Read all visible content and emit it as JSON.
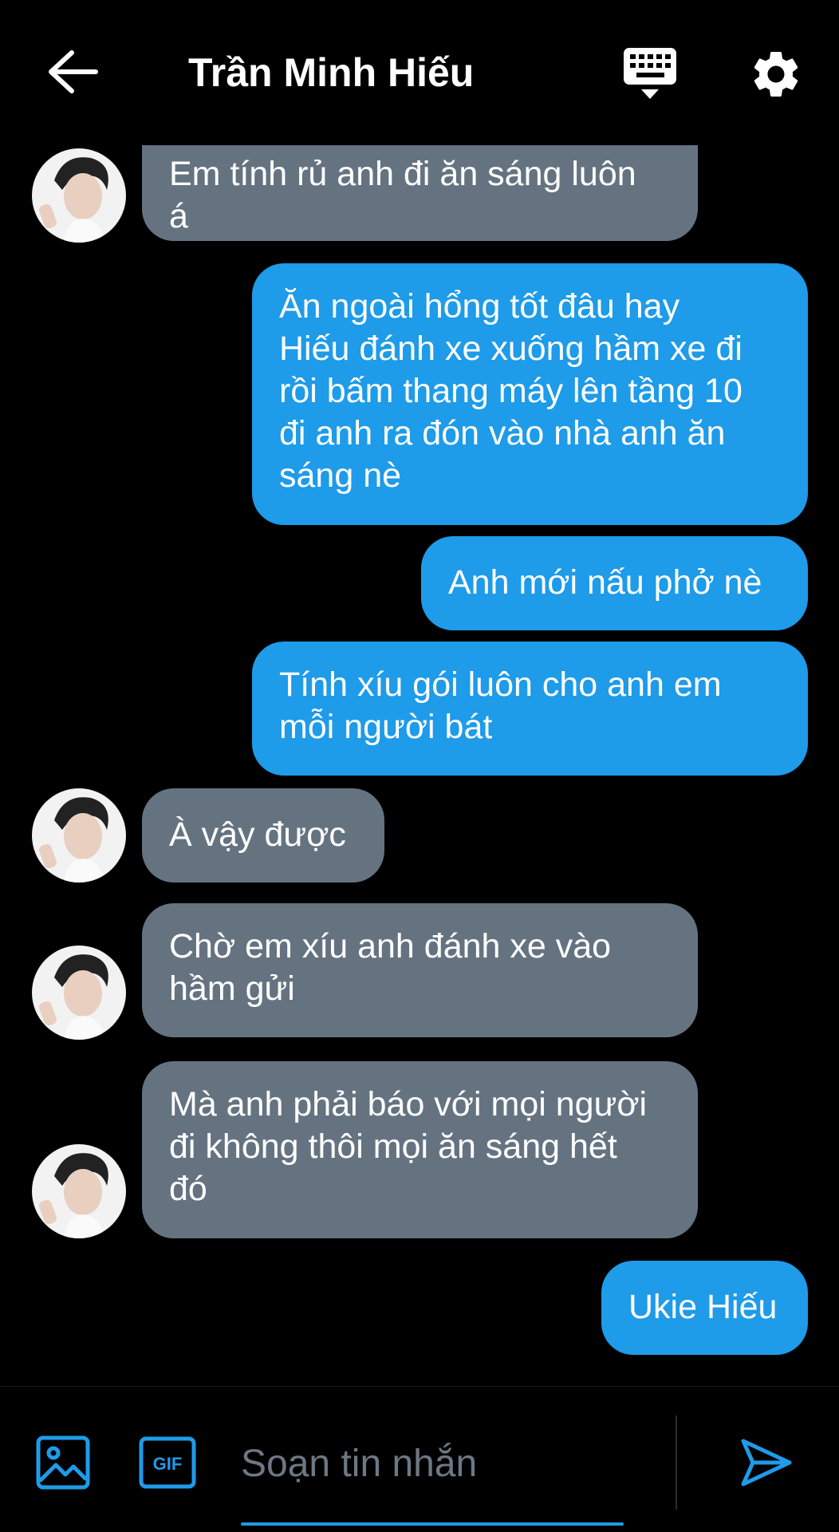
{
  "header": {
    "title": "Trần Minh Hiếu"
  },
  "messages": [
    {
      "direction": "incoming",
      "text": "Em tính rủ anh đi ăn sáng luôn\ná",
      "partially_visible": true
    },
    {
      "direction": "outgoing",
      "text": "Ăn ngoài hổng tốt đâu hay\nHiếu đánh xe xuống hầm xe đi\nrồi bấm thang máy lên tầng 10\nđi anh ra đón vào nhà anh ăn\nsáng nè"
    },
    {
      "direction": "outgoing",
      "text": "Anh mới nấu phở nè"
    },
    {
      "direction": "outgoing",
      "text": "Tính xíu gói luôn cho anh em\nmỗi người bát"
    },
    {
      "direction": "incoming",
      "text": "À vậy được"
    },
    {
      "direction": "incoming",
      "text": "Chờ em xíu anh đánh xe vào\nhầm gửi"
    },
    {
      "direction": "incoming",
      "text": "Mà anh phải báo với mọi người\nđi không thôi mọi ăn sáng hết\nđó"
    },
    {
      "direction": "outgoing",
      "text": "Ukie Hiếu"
    }
  ],
  "composer": {
    "placeholder": "Soạn tin nhắn",
    "gif_label": "GIF"
  },
  "colors": {
    "background": "#000000",
    "outgoing_bubble": "#1e9be9",
    "incoming_bubble": "#657381",
    "accent": "#1e9be9"
  },
  "icons": [
    "back-arrow-icon",
    "keyboard-icon",
    "gear-icon",
    "image-icon",
    "gif-icon",
    "send-icon"
  ]
}
